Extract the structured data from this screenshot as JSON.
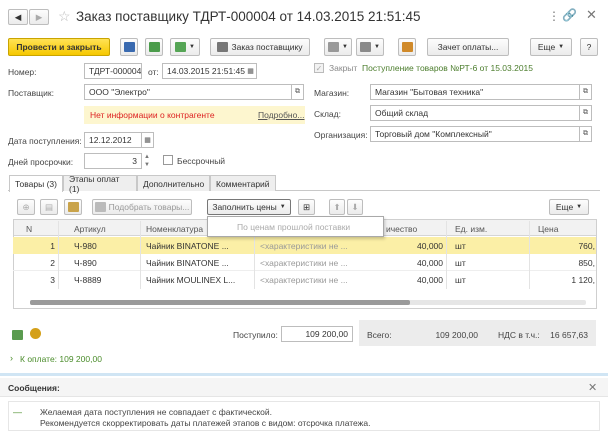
{
  "window": {
    "title": "Заказ поставщику ТДРТ-000004 от 14.03.2015 21:51:45"
  },
  "toolbar": {
    "post_close": "Провести и закрыть",
    "order_supplier": "Заказ поставщику",
    "payment_offset": "Зачет оплаты...",
    "more": "Еще"
  },
  "form": {
    "number_label": "Номер:",
    "number": "ТДРТ-000004",
    "from_label": "от:",
    "date": "14.03.2015 21:51:45",
    "supplier_label": "Поставщик:",
    "supplier": "ООО \"Электро\"",
    "warning": "Нет информации о контрагенте",
    "details_link": "Подробно...",
    "receipt_date_label": "Дата поступления:",
    "receipt_date": "12.12.2012",
    "overdue_label": "Дней просрочки:",
    "overdue_days": "3",
    "indefinite_label": "Бессрочный",
    "closed_label": "Закрыт",
    "receipt_link": "Поступление товаров №РТ-6 от 15.03.2015",
    "store_label": "Магазин:",
    "store": "Магазин \"Бытовая техника\"",
    "warehouse_label": "Склад:",
    "warehouse": "Общий склад",
    "org_label": "Организация:",
    "org": "Торговый дом \"Комплексный\""
  },
  "tabs": [
    {
      "label": "Товары (3)"
    },
    {
      "label": "Этапы оплат (1)"
    },
    {
      "label": "Дополнительно"
    },
    {
      "label": "Комментарий"
    }
  ],
  "grid_toolbar": {
    "pick_goods": "Подобрать товары...",
    "fill_prices": "Заполнить цены",
    "more": "Еще",
    "dropdown_item": "По ценам прошлой поставки"
  },
  "table": {
    "columns": [
      "N",
      "Артикул",
      "Номенклатура",
      "",
      "ичество",
      "Ед. изм.",
      "Цена"
    ],
    "rows": [
      {
        "n": "1",
        "article": "Ч-980",
        "name": "Чайник BINATONE ...",
        "char": "<характеристики не ...",
        "qty": "40,000",
        "unit": "шт",
        "price": "760,"
      },
      {
        "n": "2",
        "article": "Ч-890",
        "name": "Чайник BINATONE ...",
        "char": "<характеристики не ...",
        "qty": "40,000",
        "unit": "шт",
        "price": "850,"
      },
      {
        "n": "3",
        "article": "Ч-8889",
        "name": "Чайник MOULINEX L...",
        "char": "<характеристики не ...",
        "qty": "40,000",
        "unit": "шт",
        "price": "1 120,"
      }
    ]
  },
  "totals": {
    "received_label": "Поступило:",
    "received": "109 200,00",
    "total_label": "Всего:",
    "total": "109 200,00",
    "vat_label": "НДС в т.ч.:",
    "vat": "16 657,63",
    "to_pay": "К оплате: 109 200,00"
  },
  "messages": {
    "title": "Сообщения:",
    "line1": "Желаемая дата поступления не совпадает с фактической.",
    "line2": "Рекомендуется скорректировать даты платежей этапов с видом: отсрочка платежа."
  }
}
